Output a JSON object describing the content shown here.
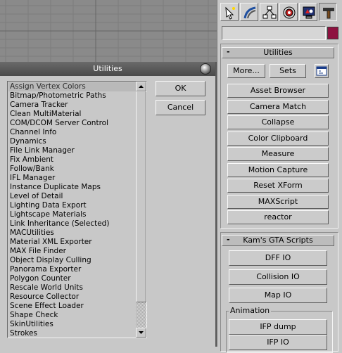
{
  "dialog": {
    "title": "Utilities",
    "items": [
      "Assign Vertex Colors",
      "Bitmap/Photometric Paths",
      "Camera Tracker",
      "Clean MultiMaterial",
      "COM/DCOM Server Control",
      "Channel Info",
      "Dynamics",
      "File Link Manager",
      "Fix Ambient",
      "Follow/Bank",
      "IFL Manager",
      "Instance Duplicate Maps",
      "Level of Detail",
      "Lighting Data Export",
      "Lightscape Materials",
      "Link Inheritance (Selected)",
      "MACUtilities",
      "Material XML Exporter",
      "MAX File Finder",
      "Object Display Culling",
      "Panorama Exporter",
      "Polygon Counter",
      "Rescale World Units",
      "Resource Collector",
      "Scene Effect Loader",
      "Shape Check",
      "SkinUtilities",
      "Strokes"
    ],
    "selected_item": "Assign Vertex Colors",
    "ok_label": "OK",
    "cancel_label": "Cancel"
  },
  "command_panel": {
    "tabs": [
      "create-icon",
      "modify-icon",
      "hierarchy-icon",
      "motion-icon",
      "display-icon",
      "utilities-icon"
    ],
    "active_tab": "utilities-icon",
    "name_field_value": "",
    "swatch_color": "#8e1240",
    "utilities_rollout": {
      "title": "Utilities",
      "collapse_symbol": "-",
      "more_label": "More...",
      "sets_label": "Sets",
      "buttons": [
        "Asset Browser",
        "Camera Match",
        "Collapse",
        "Color Clipboard",
        "Measure",
        "Motion Capture",
        "Reset XForm",
        "MAXScript",
        "reactor"
      ]
    },
    "kams_rollout": {
      "title": "Kam's GTA Scripts",
      "collapse_symbol": "-",
      "buttons": [
        "DFF IO",
        "Collision IO",
        "Map IO"
      ],
      "animation_group": {
        "label": "Animation",
        "buttons": [
          "IFP dump",
          "IFP IO"
        ]
      }
    }
  }
}
